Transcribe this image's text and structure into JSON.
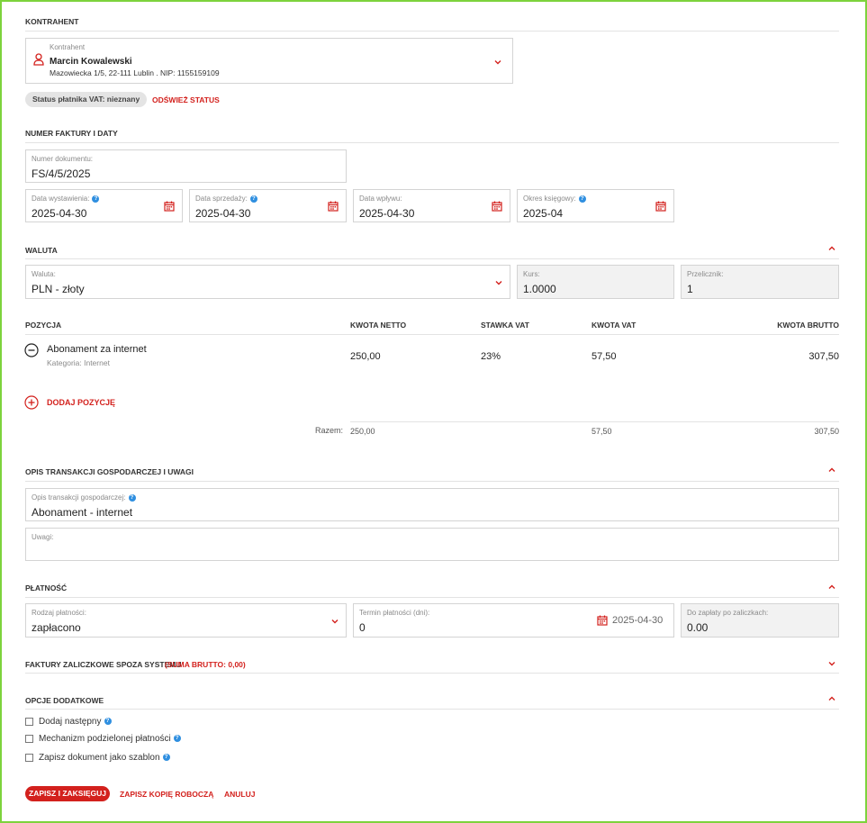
{
  "contractor": {
    "section_title": "KONTRAHENT",
    "field_label": "Kontrahent",
    "name": "Marcin Kowalewski",
    "details": "Mazowiecka 1/5, 22-111 Lublin . NIP: 1155159109",
    "vat_status": "Status płatnika VAT: nieznany",
    "refresh_label": "ODŚWIEŻ STATUS"
  },
  "invoice": {
    "section_title": "NUMER FAKTURY I DATY",
    "doc_number_label": "Numer dokumentu:",
    "doc_number": "FS/4/5/2025",
    "issue_date_label": "Data wystawienia:",
    "issue_date": "2025-04-30",
    "sale_date_label": "Data sprzedaży:",
    "sale_date": "2025-04-30",
    "receipt_date_label": "Data wpływu:",
    "receipt_date": "2025-04-30",
    "period_label": "Okres księgowy:",
    "period": "2025-04"
  },
  "currency": {
    "section_title": "WALUTA",
    "currency_label": "Waluta:",
    "currency_value": "PLN - złoty",
    "rate_label": "Kurs:",
    "rate_value": "1.0000",
    "converter_label": "Przelicznik:",
    "converter_value": "1"
  },
  "positions": {
    "headers": {
      "position": "POZYCJA",
      "net": "KWOTA NETTO",
      "vat_rate": "STAWKA VAT",
      "vat_amount": "KWOTA VAT",
      "gross": "KWOTA BRUTTO"
    },
    "items": [
      {
        "name": "Abonament za internet",
        "category": "Kategoria: Internet",
        "net": "250,00",
        "vat_rate": "23%",
        "vat_amount": "57,50",
        "gross": "307,50"
      }
    ],
    "add_label": "DODAJ POZYCJĘ",
    "total_label": "Razem:",
    "total_net": "250,00",
    "total_vat": "57,50",
    "total_gross": "307,50"
  },
  "description": {
    "section_title": "OPIS TRANSAKCJI GOSPODARCZEJ I UWAGI",
    "desc_label": "Opis transakcji gospodarczej:",
    "desc_value": "Abonament - internet",
    "notes_label": "Uwagi:",
    "notes_value": ""
  },
  "payment": {
    "section_title": "PŁATNOŚĆ",
    "type_label": "Rodzaj płatności:",
    "type_value": "zapłacono",
    "term_label": "Termin płatności (dni):",
    "term_value": "0",
    "term_date": "2025-04-30",
    "to_pay_label": "Do zapłaty po zaliczkach:",
    "to_pay_value": "0.00"
  },
  "advance": {
    "section_title": "FAKTURY ZALICZKOWE SPOZA SYSTEMU",
    "sum_label": "(SUMA BRUTTO: 0,00)"
  },
  "options": {
    "section_title": "OPCJE DODATKOWE",
    "items": [
      {
        "label": "Dodaj następny",
        "checked": false
      },
      {
        "label": "Mechanizm podzielonej płatności",
        "checked": false
      },
      {
        "label": "Zapisz dokument jako szablon",
        "checked": false
      }
    ]
  },
  "actions": {
    "save_post": "ZAPISZ I ZAKSIĘGUJ",
    "save_draft": "ZAPISZ KOPIĘ ROBOCZĄ",
    "cancel": "ANULUJ"
  },
  "colors": {
    "accent": "#d3211d",
    "info": "#2f8fe0",
    "frame": "#7dd33c"
  }
}
